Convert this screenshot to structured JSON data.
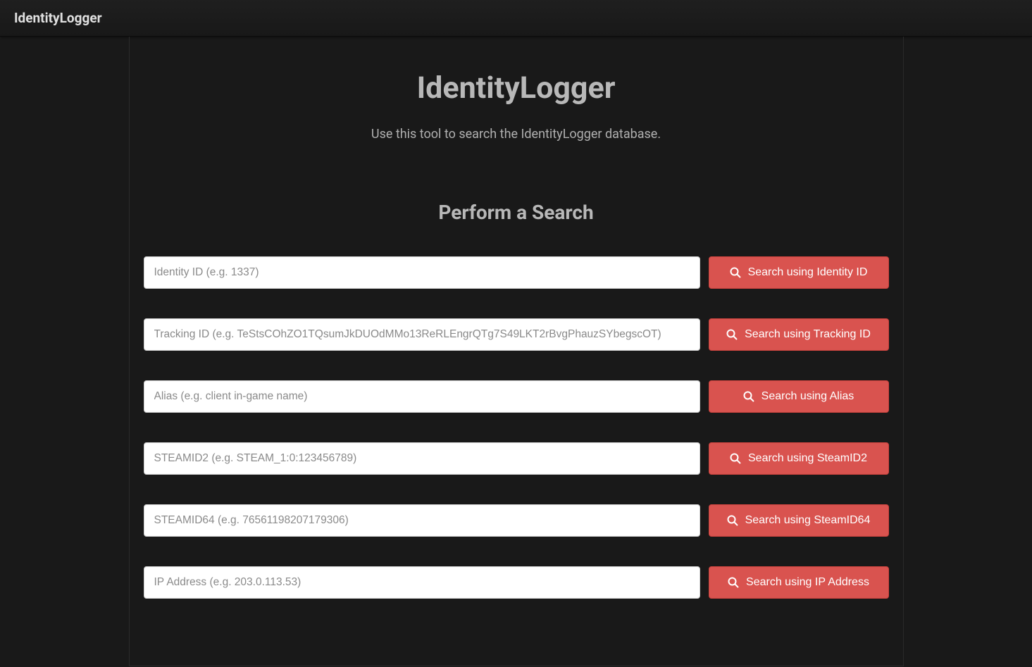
{
  "navbar": {
    "brand": "IdentityLogger"
  },
  "header": {
    "title": "IdentityLogger",
    "subtitle": "Use this tool to search the IdentityLogger database."
  },
  "search_section": {
    "title": "Perform a Search",
    "rows": [
      {
        "placeholder": "Identity ID (e.g. 1337)",
        "button_label": "Search using Identity ID"
      },
      {
        "placeholder": "Tracking ID (e.g. TeStsCOhZO1TQsumJkDUOdMMo13ReRLEngrQTg7S49LKT2rBvgPhauzSYbegscOT)",
        "button_label": "Search using Tracking ID"
      },
      {
        "placeholder": "Alias (e.g. client in-game name)",
        "button_label": "Search using Alias"
      },
      {
        "placeholder": "STEAMID2 (e.g. STEAM_1:0:123456789)",
        "button_label": "Search using SteamID2"
      },
      {
        "placeholder": "STEAMID64 (e.g. 76561198207179306)",
        "button_label": "Search using SteamID64"
      },
      {
        "placeholder": "IP Address (e.g. 203.0.113.53)",
        "button_label": "Search using IP Address"
      }
    ]
  }
}
